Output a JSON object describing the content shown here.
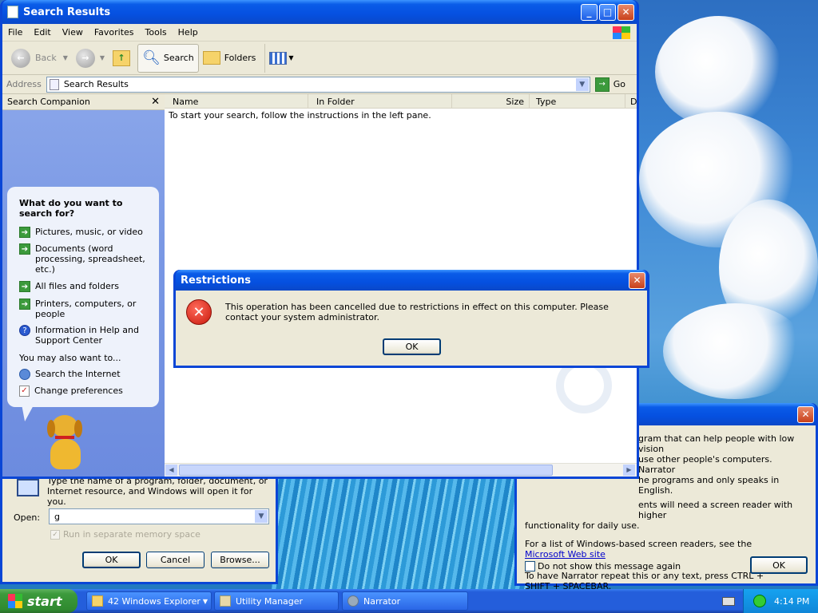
{
  "explorer": {
    "title": "Search Results",
    "menu": [
      "File",
      "Edit",
      "View",
      "Favorites",
      "Tools",
      "Help"
    ],
    "toolbar": {
      "back": "Back",
      "search": "Search",
      "folders": "Folders"
    },
    "address_label": "Address",
    "address_value": "Search Results",
    "go_label": "Go",
    "columns": [
      "Name",
      "In Folder",
      "Size",
      "Type",
      "D"
    ],
    "empty_message": "To start your search, follow the instructions in the left pane.",
    "companion": {
      "header": "Search Companion",
      "question": "What do you want to search for?",
      "options": [
        "Pictures, music, or video",
        "Documents (word processing, spreadsheet, etc.)",
        "All files and folders",
        "Printers, computers, or people",
        "Information in Help and Support Center"
      ],
      "also_label": "You may also want to...",
      "also": [
        "Search the Internet",
        "Change preferences"
      ]
    }
  },
  "dialog": {
    "title": "Restrictions",
    "message": "This operation has been cancelled due to restrictions in effect on this computer. Please contact your system administrator.",
    "ok": "OK"
  },
  "run": {
    "description": "Type the name of a program, folder, document, or Internet resource, and Windows will open it for you.",
    "open_label": "Open:",
    "open_value": "g",
    "checkbox_label": "Run in separate memory space",
    "ok": "OK",
    "cancel": "Cancel",
    "browse": "Browse..."
  },
  "narrator": {
    "lines": [
      "gram that can help people with low vision",
      "use other people's computers. Narrator",
      "he programs and only speaks in English.",
      "ents will need a screen reader with higher",
      "functionality for daily use."
    ],
    "para2": "For a list of Windows-based screen readers, see the",
    "link": "Microsoft Web site",
    "para3": "To have Narrator repeat this or any text, press CTRL + SHIFT + SPACEBAR.",
    "checkbox_label": "Do not show this message again",
    "ok": "OK"
  },
  "taskbar": {
    "start": "start",
    "items": [
      "42 Windows Explorer",
      "Utility Manager",
      "Narrator"
    ],
    "clock": "4:14 PM"
  },
  "colors": {
    "title_blue": "#0a5ce8",
    "face": "#ece9d8",
    "companion_blue": "#7a9be6",
    "error_red": "#d42a1c"
  }
}
